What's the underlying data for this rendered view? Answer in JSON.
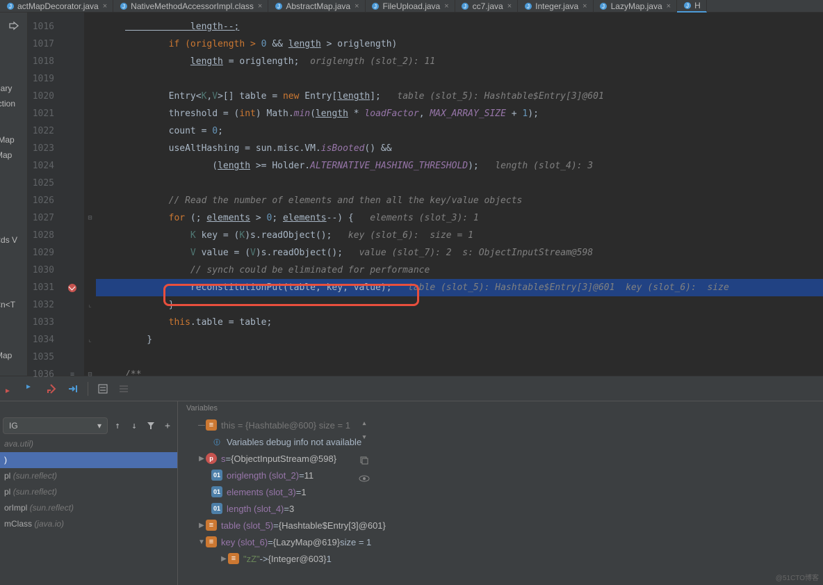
{
  "tabs": [
    {
      "label": "actMapDecorator.java"
    },
    {
      "label": "NativeMethodAccessorImpl.class"
    },
    {
      "label": "AbstractMap.java"
    },
    {
      "label": "FileUpload.java"
    },
    {
      "label": "cc7.java"
    },
    {
      "label": "Integer.java"
    },
    {
      "label": "LazyMap.java"
    },
    {
      "label": "H"
    }
  ],
  "side_labels": {
    "a": "nary",
    "b": "iction",
    "c": "tMap",
    "d": "Map",
    "e": "ds V>",
    "f": "n<T>",
    "g": "Map"
  },
  "lines": [
    {
      "n": "1016"
    },
    {
      "n": "1017"
    },
    {
      "n": "1018"
    },
    {
      "n": "1019"
    },
    {
      "n": "1020"
    },
    {
      "n": "1021"
    },
    {
      "n": "1022"
    },
    {
      "n": "1023"
    },
    {
      "n": "1024"
    },
    {
      "n": "1025"
    },
    {
      "n": "1026"
    },
    {
      "n": "1027"
    },
    {
      "n": "1028"
    },
    {
      "n": "1029"
    },
    {
      "n": "1030"
    },
    {
      "n": "1031"
    },
    {
      "n": "1032"
    },
    {
      "n": "1033"
    },
    {
      "n": "1034"
    },
    {
      "n": "1035"
    },
    {
      "n": "1036"
    }
  ],
  "code": {
    "l1016": "            length--;",
    "l1017_p1": "        if (origlength > ",
    "l1017_p2": "0",
    "l1017_p3": " && ",
    "l1017_p4": "length",
    "l1017_p5": " > origlength)",
    "l1018_p1": "            ",
    "l1018_p2": "length",
    "l1018_p3": " = origlength;",
    "l1018_h": "  origlength (slot_2): 11",
    "l1020_p1": "        Entry<",
    "l1020_p2": "K",
    "l1020_p3": ",",
    "l1020_p4": "V",
    "l1020_p5": ">[] table = ",
    "l1020_p6": "new",
    "l1020_p7": " Entry[",
    "l1020_p8": "length",
    "l1020_p9": "];",
    "l1020_h": "   table (slot_5): Hashtable$Entry[3]@601",
    "l1021_p1": "        threshold = (",
    "l1021_p2": "int",
    "l1021_p3": ") Math.",
    "l1021_p4": "min",
    "l1021_p5": "(",
    "l1021_p6": "length",
    "l1021_p7": " * ",
    "l1021_p8": "loadFactor",
    "l1021_p9": ", ",
    "l1021_p10": "MAX_ARRAY_SIZE",
    "l1021_p11": " + ",
    "l1021_p12": "1",
    "l1021_p13": ");",
    "l1022_p1": "        count = ",
    "l1022_p2": "0",
    "l1022_p3": ";",
    "l1023_p1": "        useAltHashing = sun.misc.VM.",
    "l1023_p2": "isBooted",
    "l1023_p3": "() &&",
    "l1024_p1": "                (",
    "l1024_p2": "length",
    "l1024_p3": " >= Holder.",
    "l1024_p4": "ALTERNATIVE_HASHING_THRESHOLD",
    "l1024_p5": ");",
    "l1024_h": "   length (slot_4): 3",
    "l1026": "        // Read the number of elements and then all the key/value objects",
    "l1027_p1": "        for",
    "l1027_p2": " (; ",
    "l1027_p3": "elements",
    "l1027_p4": " > ",
    "l1027_p5": "0",
    "l1027_p6": "; ",
    "l1027_p7": "elements",
    "l1027_p8": "--) {",
    "l1027_h": "   elements (slot_3): 1",
    "l1028_p1": "            ",
    "l1028_p2": "K",
    "l1028_p3": " key = (",
    "l1028_p4": "K",
    "l1028_p5": ")s.readObject();",
    "l1028_h": "   key (slot_6):  size = 1",
    "l1029_p1": "            ",
    "l1029_p2": "V",
    "l1029_p3": " value = (",
    "l1029_p4": "V",
    "l1029_p5": ")s.readObject();",
    "l1029_h": "   value (slot_7): 2  s: ObjectInputStream@598",
    "l1030": "            // synch could be eliminated for performance",
    "l1031_p1": "            reconstitutionPut(table",
    "l1031_p2": ", ",
    "l1031_p3": "key",
    "l1031_p4": ", ",
    "l1031_p5": "value);",
    "l1031_h": "   table (slot_5): Hashtable$Entry[3]@601  key (slot_6):  size",
    "l1032": "        }",
    "l1033_p1": "        this",
    "l1033_p2": ".table = table;",
    "l1034": "    }",
    "l1036": "/**"
  },
  "vars_header": "Variables",
  "frames_dd": "IG",
  "frames": [
    {
      "main": "ava.util)",
      "pkg": ""
    },
    {
      "main": ")",
      "pkg": ""
    },
    {
      "main": "pl ",
      "pkg": "(sun.reflect)"
    },
    {
      "main": "pl ",
      "pkg": "(sun.reflect)"
    },
    {
      "main": "orImpl ",
      "pkg": "(sun.reflect)"
    },
    {
      "main": "mClass ",
      "pkg": "(java.io)"
    }
  ],
  "vars_lines": {
    "this": "this = {Hashtable@600}  size = 1",
    "info": "Variables debug info not available",
    "s_name": "s",
    "s_eq": " = ",
    "s_val": "{ObjectInputStream@598}",
    "orig_name": "origlength (slot_2)",
    "orig_eq": " = ",
    "orig_val": "11",
    "elem_name": "elements (slot_3)",
    "elem_eq": " = ",
    "elem_val": "1",
    "len_name": "length (slot_4)",
    "len_eq": " = ",
    "len_val": "3",
    "tab_name": "table (slot_5)",
    "tab_eq": " = ",
    "tab_val": "{Hashtable$Entry[3]@601}",
    "key_name": "key (slot_6)",
    "key_eq": " = ",
    "key_val": "{LazyMap@619}",
    "key_size": "  size = 1",
    "zz_k": "\"zZ\"",
    "zz_arrow": " -> ",
    "zz_v": "{Integer@603}",
    "zz_n": " 1"
  },
  "watermark": "@51CTO博客"
}
